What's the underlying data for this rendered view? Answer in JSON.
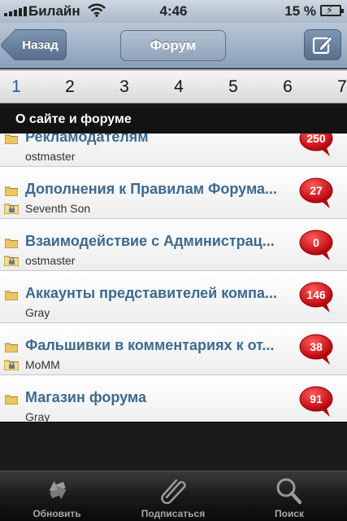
{
  "status_bar": {
    "carrier": "Билайн",
    "time": "4:46",
    "battery_percent": "15 %",
    "battery_level": 0.15
  },
  "nav_bar": {
    "back_label": "Назад",
    "title": "Форум",
    "compose_icon": "compose-icon"
  },
  "pager": {
    "pages": [
      "1",
      "2",
      "3",
      "4",
      "5",
      "6",
      "7"
    ],
    "current": "1"
  },
  "section": {
    "title": "О сайте и форуме"
  },
  "topics": [
    {
      "title": "Рекламодателям",
      "author": "ostmaster",
      "count": "250",
      "locked": false
    },
    {
      "title": "Дополнения к Правилам Форума...",
      "author": "Seventh Son",
      "count": "27",
      "locked": true
    },
    {
      "title": "Взаимодействие с Администрац...",
      "author": "ostmaster",
      "count": "0",
      "locked": true
    },
    {
      "title": "Аккаунты представителей компа...",
      "author": "Gray",
      "count": "146",
      "locked": false
    },
    {
      "title": "Фальшивки в комментариях к от...",
      "author": "MoMM",
      "count": "38",
      "locked": true
    },
    {
      "title": "Магазин форума",
      "author": "Gray",
      "count": "91",
      "locked": false
    }
  ],
  "tab_bar": {
    "refresh_label": "Обновить",
    "subscribe_label": "Подписаться",
    "search_label": "Поиск"
  },
  "colors": {
    "link_title": "#3d6a91",
    "badge_red": "#d8141b",
    "current_page": "#2a5b9a"
  }
}
